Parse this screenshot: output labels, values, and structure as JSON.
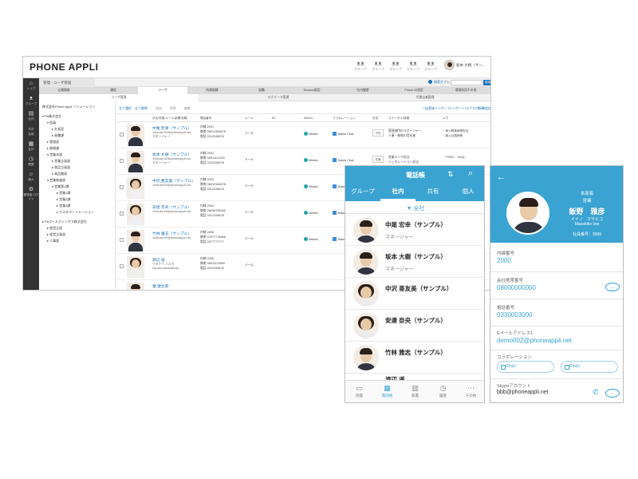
{
  "desktop": {
    "brand": "PHONE APPLI",
    "groups": [
      {
        "icon": "people-icon",
        "label": "グループ"
      },
      {
        "icon": "people-icon",
        "label": "グループ"
      },
      {
        "icon": "people-icon",
        "label": "グループ"
      },
      {
        "icon": "people-icon",
        "label": "グループ"
      },
      {
        "icon": "people-icon",
        "label": "グループ"
      }
    ],
    "user_name": "坂本 大樹（サン...",
    "sidebar": [
      {
        "icon": "home-icon",
        "label": "トップ"
      },
      {
        "icon": "group-icon",
        "label": "グループ"
      },
      {
        "icon": "contacts-icon",
        "label": "社内"
      },
      {
        "icon": "card-icon",
        "label": "名刺"
      },
      {
        "icon": "address-icon",
        "label": "社外"
      },
      {
        "icon": "history-icon",
        "label": "履歴"
      },
      {
        "icon": "person-icon",
        "label": "個人"
      },
      {
        "icon": "admin-icon",
        "label": "管理者 ログイン"
      }
    ],
    "breadcrumb": "管理 - ユーザ管理",
    "search_option": "検索オプション",
    "search_button": "検索",
    "tabs": [
      "企業情報",
      "課程",
      "ユーザ",
      "所属組織",
      "役職",
      "Session設定",
      "社内履歴",
      "Phone ID設定",
      "環境利用その他"
    ],
    "subtabs": [
      "ユーザ管理",
      "ログデータ管理",
      "代理店者管理"
    ],
    "tree": [
      "株式会社Phone Appli  ソリューション",
      "▾ PA株式会社",
      "▾ 役員",
      "▸ 社長室",
      "▸ 秘書課",
      "▸ 管理部",
      "▸ 総務課",
      "▾ 営業本部",
      "▸ 営業企画部",
      "▸ 商品企画部",
      "▸ 商品開発",
      "▾ 営業推進部",
      "▾ 営業第1課",
      "▸ 営業1課",
      "▸ 営業2課",
      "▸ 営業3課",
      "▸ カスタマーリレーション",
      "▸ PAホールディングス株式会社",
      "▸ 経営企画",
      "▸ 経営企画部",
      "▸ 人事部"
    ],
    "toolbar": {
      "select_all": "全て選択",
      "deselect_all": "全て解除",
      "b1": "追加",
      "b2": "削除",
      "b3": "編集",
      "right1": "一括登録インポート",
      "right2": "インポート/エクスポート",
      "right3": "新規追加"
    },
    "columns": [
      "氏名/所属/メール/部署/役職",
      "電話番号",
      "メール",
      "IM",
      "Webex",
      "コラボレーション",
      "在宅",
      "ステータス/役職",
      "メモ"
    ],
    "rows": [
      {
        "name": "中尾 宏幸（サンプル）",
        "email": "1m5user01@phoneappli.net",
        "extra": "マネージャー",
        "ext": "内線 2001",
        "mobile": "携帯 08012345678",
        "tel": "電話 0312345678",
        "mail": "メール",
        "webex": "Webex",
        "teams": "Teams Chat",
        "zone": "不在",
        "pos1": "管理部門のマネージャー",
        "pos2": "人事・総務の責任者",
        "note1": "・新人教育研修担当",
        "note2": "・新入社員研修"
      },
      {
        "name": "坂本 大樹（サンプル）",
        "email": "1m5user02@phoneappli.net",
        "extra": "マネージャー",
        "ext": "内線 2002",
        "mobile": "携帯 08011112222",
        "tel": "電話 0312345678",
        "mail": "メール",
        "webex": "Webex",
        "teams": "Teams Chat",
        "zone": "在席",
        "pos1": "営業エリア担当",
        "pos2": "ジェネレーション担当",
        "note1": "・TOEIC：700点",
        "note2": ""
      },
      {
        "name": "中沢 亜友美（サンプル）",
        "email": "1m5user03@phoneappli.net",
        "extra": "",
        "ext": "内線 2003",
        "mobile": "携帯 08012345678",
        "tel": "電話 0312345678",
        "mail": "メール",
        "webex": "Webex",
        "teams": "Teams Chat",
        "zone": "",
        "pos1": "",
        "pos2": "",
        "note1": "",
        "note2": ""
      },
      {
        "name": "安達 奈央（サンプル）",
        "email": "1m5user04@phoneappli.net",
        "extra": "",
        "ext": "内線 2004",
        "mobile": "携帯 08098765432",
        "tel": "電話 0312345678",
        "mail": "メール",
        "webex": "Webex",
        "teams": "Teams Chat",
        "zone": "",
        "pos1": "",
        "pos2": "",
        "note1": "",
        "note2": ""
      },
      {
        "name": "竹林 雅志（サンプル）",
        "email": "1m5user05@phoneappli.net",
        "extra": "",
        "ext": "内線 2005",
        "mobile": "携帯 07077776666",
        "tel": "電話 0377777777",
        "mail": "メール",
        "webex": "Webex",
        "teams": "Teams Chat",
        "zone": "",
        "pos1": "",
        "pos2": "",
        "note1": "",
        "note2": ""
      },
      {
        "name": "渡辺 遥",
        "email": "ワタナベ ハルカ",
        "extra": "haruka.watanabe@...",
        "ext": "内線 2006",
        "mobile": "携帯 08011119999",
        "tel": "電話 0312345678",
        "mail": "メール",
        "webex": "",
        "teams": "",
        "zone": "",
        "pos1": "",
        "pos2": "",
        "note1": "",
        "note2": ""
      },
      {
        "name": "葉 健太郎",
        "email": "",
        "extra": "",
        "ext": "",
        "mobile": "",
        "tel": "",
        "mail": "",
        "webex": "",
        "teams": "",
        "zone": "",
        "pos1": "",
        "pos2": "",
        "note1": "",
        "note2": ""
      }
    ]
  },
  "phone1": {
    "title": "電話帳",
    "tabs": [
      "グループ",
      "社内",
      "共有",
      "個人"
    ],
    "all": "▼ 全社",
    "contacts": [
      {
        "name": "中尾 宏幸（サンプル）",
        "title": "マネージャー"
      },
      {
        "name": "坂本 大樹（サンプル）",
        "title": "マネージャー"
      },
      {
        "name": "中沢 亜友美（サンプル）",
        "title": ""
      },
      {
        "name": "安達 奈央（サンプル）",
        "title": ""
      },
      {
        "name": "竹林 雅志（サンプル）",
        "title": ""
      },
      {
        "name": "渡辺 遥",
        "title": ""
      }
    ],
    "nav": [
      {
        "icon": "card-icon",
        "label": "顔面"
      },
      {
        "icon": "list-icon",
        "label": "電話帳"
      },
      {
        "icon": "building-icon",
        "label": "部署"
      },
      {
        "icon": "clock-icon",
        "label": "履歴"
      },
      {
        "icon": "more-icon",
        "label": "その他"
      }
    ]
  },
  "phone2": {
    "dept": "本部長",
    "section": "営業",
    "name": "飯野　雅彦",
    "kana": "イイノ　マサヒコ",
    "roman": "Masahiko Iino",
    "emp_no": "社員番号：9999",
    "fields": [
      {
        "label": "内線番号",
        "value": "2000"
      },
      {
        "label": "会社携帯番号",
        "value": "08000000000"
      },
      {
        "label": "電話番号",
        "value": "0330003000"
      },
      {
        "label": "Eメールアドレス1",
        "value": "demo002@phoneappli.net"
      }
    ],
    "collab_label": "コラボレーション",
    "chat1": "Chat1",
    "chat2": "Chat1",
    "skype_label": "Skypeアカウント",
    "skype_value": "bbb@phoneappli.net"
  },
  "colors": {
    "accent": "#3aa3d2",
    "link": "#1b6fb5",
    "sidebar": "#333333"
  }
}
